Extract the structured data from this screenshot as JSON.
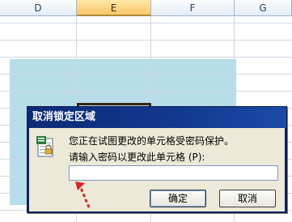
{
  "spreadsheet": {
    "columns": [
      "D",
      "E",
      "F",
      "G"
    ],
    "selected_column": "E",
    "range_fill_color": "#b7dde8",
    "active_cell_border_color": "#3b2514"
  },
  "dialog": {
    "title": "取消锁定区域",
    "icon": "lock-protected-sheet-icon",
    "message": "您正在试图更改的单元格受密码保护。",
    "prompt": "请输入密码以更改此单元格 (P):",
    "password_value": "",
    "ok_label": "确定",
    "cancel_label": "取消",
    "title_bar_color": "#0a246a"
  },
  "annotation": {
    "arrow_color": "#d9262b",
    "arrow_icon": "red-dashed-arrow-icon"
  }
}
